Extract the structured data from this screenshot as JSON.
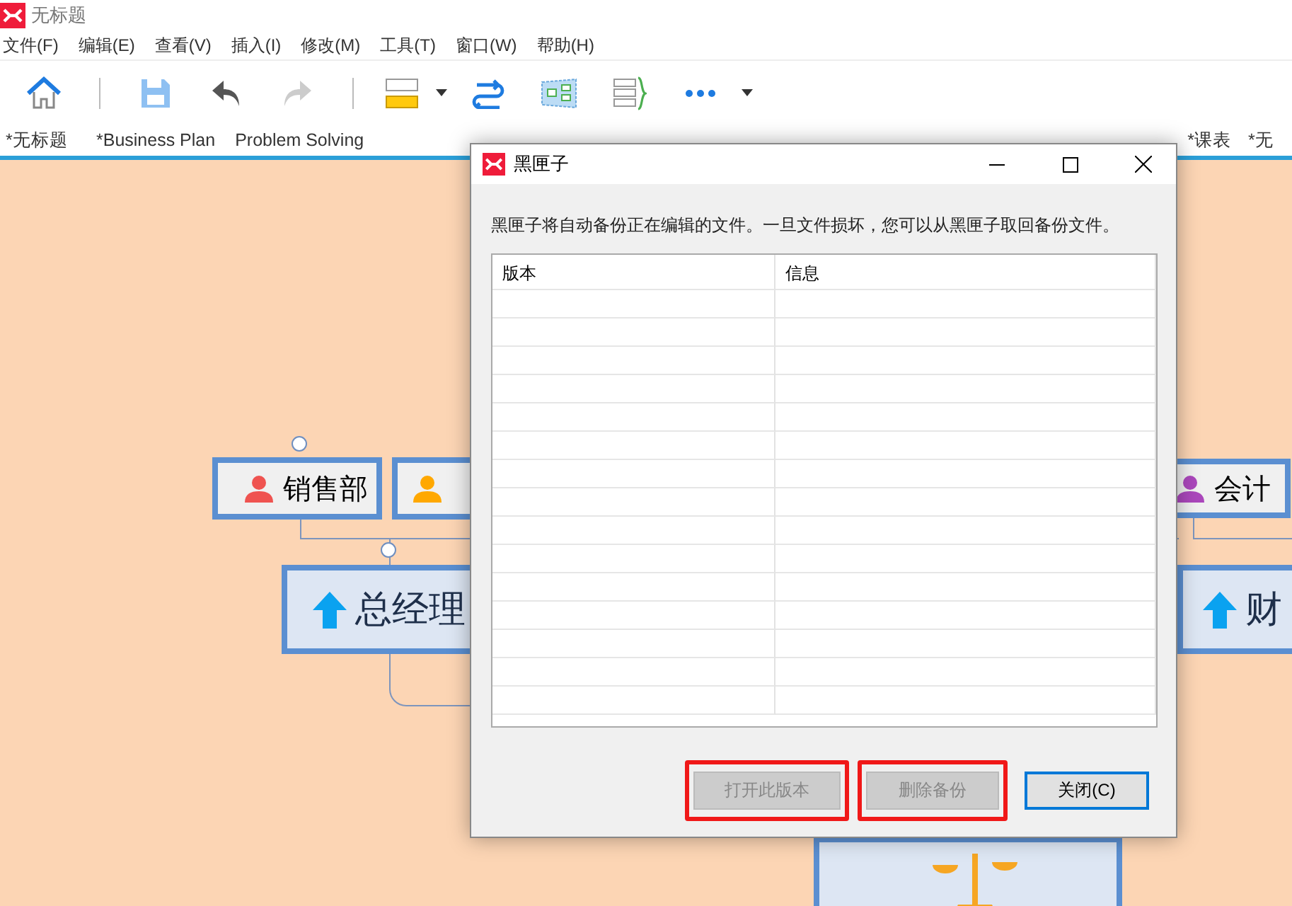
{
  "window": {
    "title": "无标题"
  },
  "menu": [
    "文件(F)",
    "编辑(E)",
    "查看(V)",
    "插入(I)",
    "修改(M)",
    "工具(T)",
    "窗口(W)",
    "帮助(H)"
  ],
  "toolbar": [
    {
      "kind": "home",
      "disabled": false
    },
    {
      "kind": "sep"
    },
    {
      "kind": "save",
      "disabled": false
    },
    {
      "kind": "undo",
      "disabled": false
    },
    {
      "kind": "redo",
      "disabled": true
    },
    {
      "kind": "sep"
    },
    {
      "kind": "structure"
    },
    {
      "kind": "caret"
    },
    {
      "kind": "relationship"
    },
    {
      "kind": "boundary"
    },
    {
      "kind": "summary"
    },
    {
      "kind": "more"
    },
    {
      "kind": "caret"
    }
  ],
  "tabs": [
    "*无标题",
    "*Business Plan",
    "Problem Solving",
    "*课表",
    "*无"
  ],
  "canvas": {
    "nodes": [
      {
        "kind": "dept",
        "label": "销售部",
        "color": "#ef5350"
      },
      {
        "kind": "dept",
        "color": "#ffa800"
      },
      {
        "kind": "dept",
        "label": "会计",
        "color": "#ab47bc"
      },
      {
        "kind": "main",
        "label": "总经理"
      },
      {
        "kind": "main",
        "label": "财"
      },
      {
        "kind": "scale"
      }
    ]
  },
  "dialog": {
    "title": "黑匣子",
    "message": "黑匣子将自动备份正在编辑的文件。一旦文件损坏，您可以从黑匣子取回备份文件。",
    "columns": [
      "版本",
      "信息"
    ],
    "buttons": [
      {
        "label": "打开此版本",
        "disabled": true,
        "highlighted": true,
        "default": false
      },
      {
        "label": "删除备份",
        "disabled": true,
        "highlighted": true,
        "default": false
      },
      {
        "label": "关闭(C)",
        "disabled": false,
        "highlighted": false,
        "default": true
      }
    ]
  }
}
